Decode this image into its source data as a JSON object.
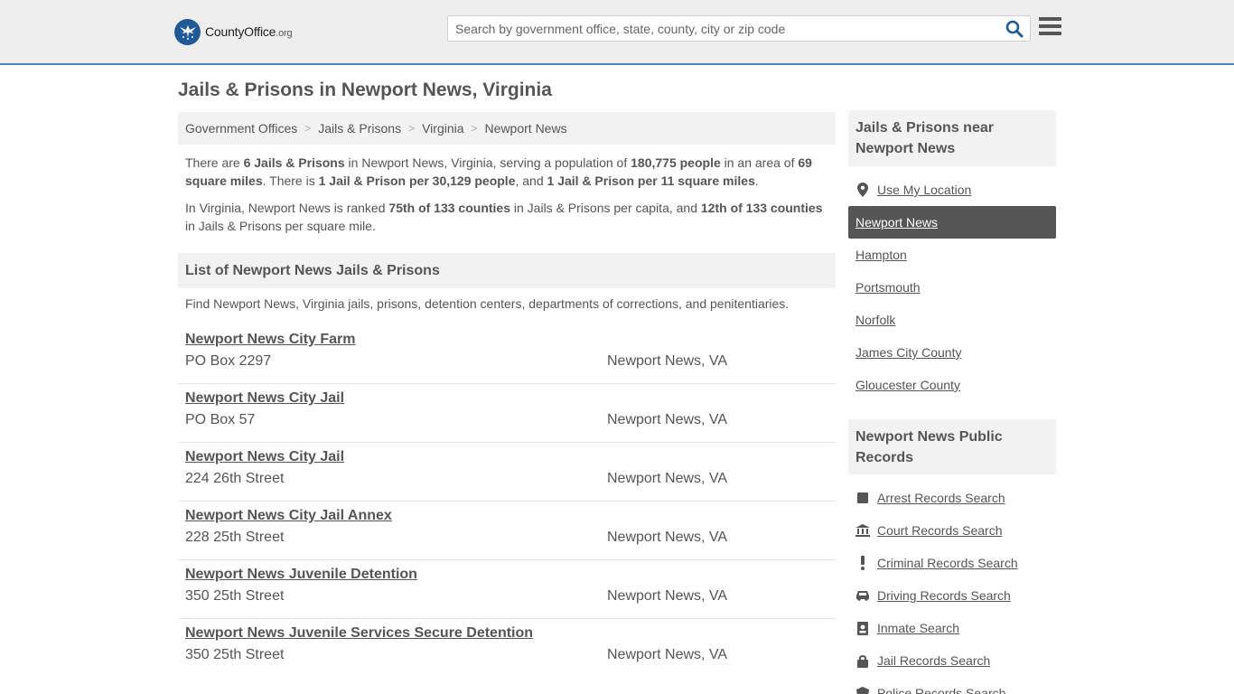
{
  "header": {
    "logo_main": "CountyOffice",
    "logo_suffix": ".org",
    "search_placeholder": "Search by government office, state, county, city or zip code"
  },
  "page": {
    "title": "Jails & Prisons in Newport News, Virginia"
  },
  "breadcrumb": [
    "Government Offices",
    "Jails & Prisons",
    "Virginia",
    "Newport News"
  ],
  "intro": {
    "p1_a": "There are ",
    "p1_b": "6 Jails & Prisons",
    "p1_c": " in Newport News, Virginia, serving a population of ",
    "p1_d": "180,775 people",
    "p1_e": " in an area of ",
    "p1_f": "69 square miles",
    "p1_g": ". There is ",
    "p1_h": "1 Jail & Prison per 30,129 people",
    "p1_i": ", and ",
    "p1_j": "1 Jail & Prison per 11 square miles",
    "p1_k": ".",
    "p2_a": "In Virginia, Newport News is ranked ",
    "p2_b": "75th of 133 counties",
    "p2_c": " in Jails & Prisons per capita, and ",
    "p2_d": "12th of 133 counties",
    "p2_e": " in Jails & Prisons per square mile."
  },
  "list": {
    "heading": "List of Newport News Jails & Prisons",
    "description": "Find Newport News, Virginia jails, prisons, detention centers, departments of corrections, and penitentiaries.",
    "entries": [
      {
        "name": "Newport News City Farm",
        "address": "PO Box 2297",
        "city": "Newport News, VA"
      },
      {
        "name": "Newport News City Jail",
        "address": "PO Box 57",
        "city": "Newport News, VA"
      },
      {
        "name": "Newport News City Jail",
        "address": "224 26th Street",
        "city": "Newport News, VA"
      },
      {
        "name": "Newport News City Jail Annex",
        "address": "228 25th Street",
        "city": "Newport News, VA"
      },
      {
        "name": "Newport News Juvenile Detention",
        "address": "350 25th Street",
        "city": "Newport News, VA"
      },
      {
        "name": "Newport News Juvenile Services Secure Detention",
        "address": "350 25th Street",
        "city": "Newport News, VA"
      }
    ]
  },
  "sidebar": {
    "nearby_heading": "Jails & Prisons near Newport News",
    "use_location": "Use My Location",
    "nearby": [
      "Newport News",
      "Hampton",
      "Portsmouth",
      "Norfolk",
      "James City County",
      "Gloucester County"
    ],
    "records_heading": "Newport News Public Records",
    "records": [
      {
        "label": "Arrest Records Search",
        "icon": "square-icon"
      },
      {
        "label": "Court Records Search",
        "icon": "courthouse-icon"
      },
      {
        "label": "Criminal Records Search",
        "icon": "exclamation-icon"
      },
      {
        "label": "Driving Records Search",
        "icon": "car-icon"
      },
      {
        "label": "Inmate Search",
        "icon": "id-card-icon"
      },
      {
        "label": "Jail Records Search",
        "icon": "lock-icon"
      },
      {
        "label": "Police Records Search",
        "icon": "badge-icon"
      }
    ]
  },
  "colors": {
    "accent": "#4a86c5",
    "logo_blue": "#1f5a96",
    "text": "#555555",
    "active_bg": "#555555"
  }
}
